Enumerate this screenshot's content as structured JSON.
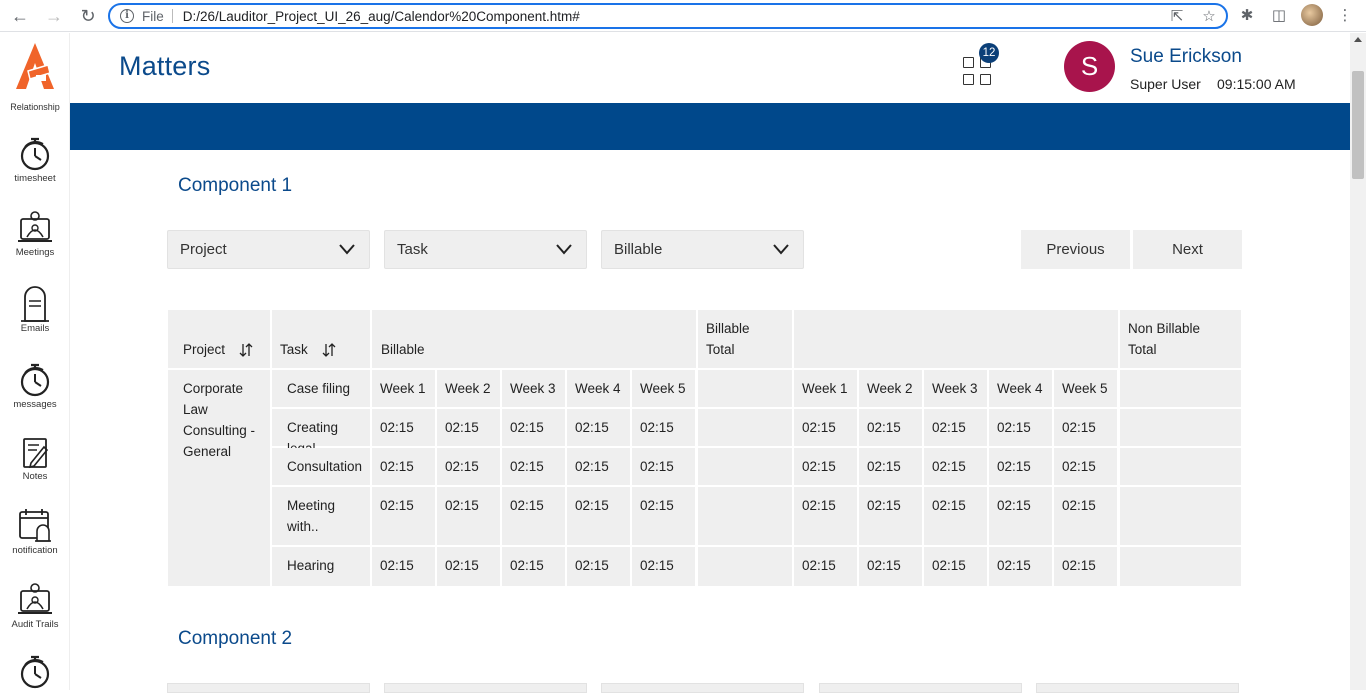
{
  "browser": {
    "scheme": "File",
    "url": "D:/26/Lauditor_Project_UI_26_aug/Calendor%20Component.htm#"
  },
  "sidebar": {
    "cut_label": "Relationship",
    "items": [
      {
        "label": "timesheet",
        "icon": "stopwatch-icon"
      },
      {
        "label": "Meetings",
        "icon": "meeting-icon"
      },
      {
        "label": "Emails",
        "icon": "mailbox-icon"
      },
      {
        "label": "messages",
        "icon": "stopwatch-icon"
      },
      {
        "label": "Notes",
        "icon": "notes-icon"
      },
      {
        "label": "notification",
        "icon": "calendar-bell-icon"
      },
      {
        "label": "Audit Trails",
        "icon": "meeting-icon"
      }
    ]
  },
  "header": {
    "title": "Matters",
    "apps_badge": "12",
    "avatar_initial": "S",
    "user_name": "Sue Erickson",
    "user_role": "Super User",
    "user_time": "09:15:00 AM"
  },
  "component1": {
    "title": "Component 1",
    "filters": [
      "Project",
      "Task",
      "Billable"
    ],
    "prev_label": "Previous",
    "next_label": "Next",
    "table": {
      "col_project": "Project",
      "col_task": "Task",
      "col_billable": "Billable",
      "col_billable_total": "Billable Total",
      "col_nonbillable_total": "Non Billable Total",
      "project_name": "Corporate Law Consulting - General",
      "weeks": [
        "Week 1",
        "Week 2",
        "Week 3",
        "Week 4",
        "Week 5"
      ],
      "rows": [
        {
          "task": "Case filing",
          "billable": [
            "Week 1",
            "Week 2",
            "Week 3",
            "Week 4",
            "Week 5"
          ],
          "nonbillable": [
            "Week 1",
            "Week 2",
            "Week 3",
            "Week 4",
            "Week 5"
          ]
        },
        {
          "task": "Creating legal",
          "billable": [
            "02:15",
            "02:15",
            "02:15",
            "02:15",
            "02:15"
          ],
          "nonbillable": [
            "02:15",
            "02:15",
            "02:15",
            "02:15",
            "02:15"
          ]
        },
        {
          "task": "Consultation",
          "billable": [
            "02:15",
            "02:15",
            "02:15",
            "02:15",
            "02:15"
          ],
          "nonbillable": [
            "02:15",
            "02:15",
            "02:15",
            "02:15",
            "02:15"
          ]
        },
        {
          "task": "Meeting with..",
          "billable": [
            "02:15",
            "02:15",
            "02:15",
            "02:15",
            "02:15"
          ],
          "nonbillable": [
            "02:15",
            "02:15",
            "02:15",
            "02:15",
            "02:15"
          ]
        },
        {
          "task": "Hearing",
          "billable": [
            "02:15",
            "02:15",
            "02:15",
            "02:15",
            "02:15"
          ],
          "nonbillable": [
            "02:15",
            "02:15",
            "02:15",
            "02:15",
            "02:15"
          ]
        }
      ]
    }
  },
  "component2": {
    "title": "Component 2"
  },
  "colors": {
    "brand_blue": "#0b4a8b",
    "banner": "#00488b",
    "avatar": "#a8144c",
    "logo_orange": "#f0642a"
  }
}
